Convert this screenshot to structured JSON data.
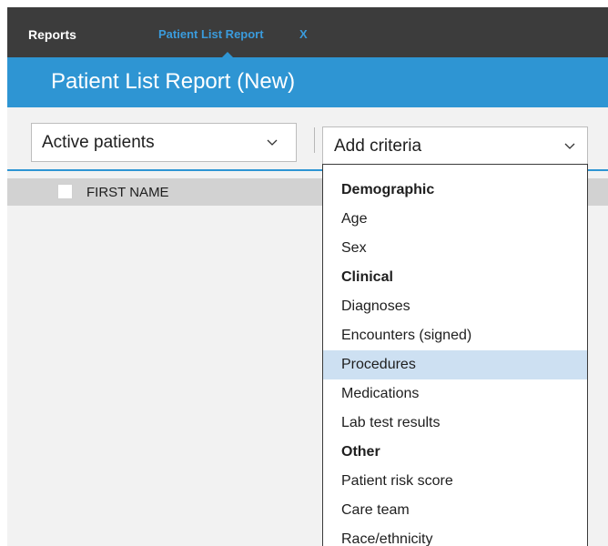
{
  "tabs": {
    "reports_label": "Reports",
    "active_label": "Patient List Report",
    "close_label": "X"
  },
  "header": {
    "title": "Patient List Report (New)"
  },
  "filters": {
    "patient_select": "Active patients",
    "criteria_select": "Add criteria"
  },
  "table": {
    "columns": [
      "FIRST NAME"
    ]
  },
  "criteria_menu": {
    "highlighted": "Procedures",
    "items": [
      {
        "label": "Demographic",
        "kind": "group"
      },
      {
        "label": "Age",
        "kind": "option"
      },
      {
        "label": "Sex",
        "kind": "option"
      },
      {
        "label": "Clinical",
        "kind": "group"
      },
      {
        "label": "Diagnoses",
        "kind": "option"
      },
      {
        "label": "Encounters (signed)",
        "kind": "option"
      },
      {
        "label": "Procedures",
        "kind": "option"
      },
      {
        "label": "Medications",
        "kind": "option"
      },
      {
        "label": "Lab test results",
        "kind": "option"
      },
      {
        "label": "Other",
        "kind": "group"
      },
      {
        "label": "Patient risk score",
        "kind": "option"
      },
      {
        "label": "Care team",
        "kind": "option"
      },
      {
        "label": "Race/ethnicity",
        "kind": "option"
      }
    ]
  },
  "icons": {
    "chevron": "chevron-down-icon",
    "checkbox": "checkbox-icon"
  },
  "colors": {
    "tab_bar": "#3c3c3c",
    "accent_blue": "#2e95d3",
    "tab_active_text": "#3a9bdc",
    "highlight": "#cde0f2",
    "table_header": "#d2d2d2",
    "canvas": "#f2f2f2"
  }
}
